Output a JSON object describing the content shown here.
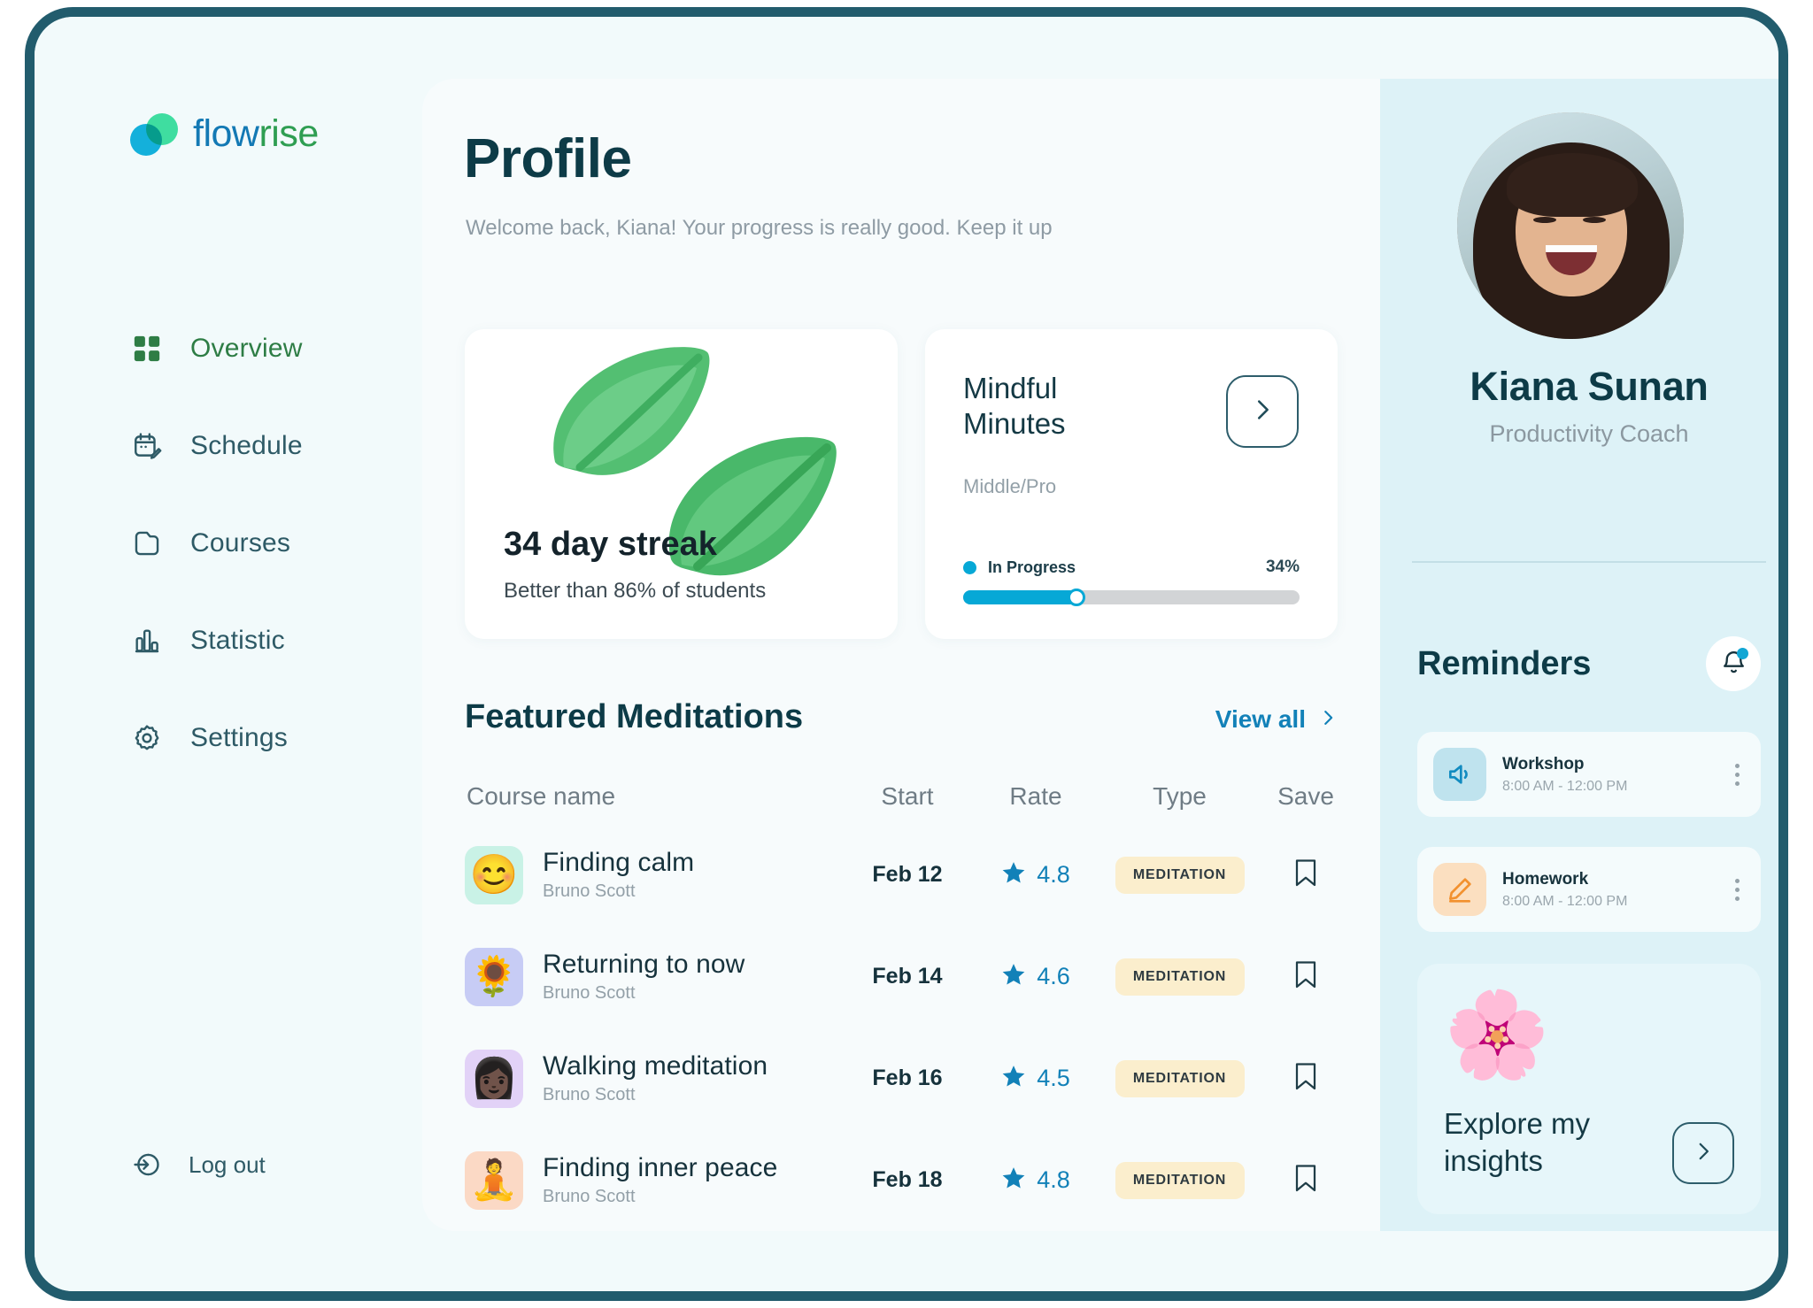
{
  "brand": {
    "name_part1": "flow",
    "name_part2": "rise"
  },
  "sidebar": {
    "items": [
      {
        "label": "Overview",
        "icon": "grid-icon",
        "active": true
      },
      {
        "label": "Schedule",
        "icon": "calendar-edit-icon",
        "active": false
      },
      {
        "label": "Courses",
        "icon": "folder-icon",
        "active": false
      },
      {
        "label": "Statistic",
        "icon": "bar-chart-icon",
        "active": false
      },
      {
        "label": "Settings",
        "icon": "gear-icon",
        "active": false
      }
    ],
    "logout_label": "Log out",
    "logout_icon": "logout-icon"
  },
  "main": {
    "title": "Profile",
    "subtitle": "Welcome back, Kiana! Your progress is really good. Keep it up",
    "streak_card": {
      "value": "34 day streak",
      "subtitle": "Better than 86% of students",
      "illustration": "leaf-icon"
    },
    "mindful_card": {
      "title": "Mindful Minutes",
      "level": "Middle/Pro",
      "progress_label": "In Progress",
      "progress_percent": "34%",
      "progress_value": 34,
      "arrow_icon": "chevron-right-icon"
    },
    "featured": {
      "title": "Featured Meditations",
      "view_all_label": "View all",
      "view_all_icon": "chevron-right-icon",
      "columns": [
        "Course name",
        "Start",
        "Rate",
        "Type",
        "Save"
      ],
      "rows": [
        {
          "name": "Finding calm",
          "author": "Bruno Scott",
          "start": "Feb 12",
          "rate": "4.8",
          "type": "MEDITATION",
          "emoji": "😊",
          "avatar_bg": "#c9f2e6",
          "save_icon": "bookmark-icon"
        },
        {
          "name": "Returning to now",
          "author": "Bruno Scott",
          "start": "Feb 14",
          "rate": "4.6",
          "type": "MEDITATION",
          "emoji": "🌻",
          "avatar_bg": "#c7ccf5",
          "save_icon": "bookmark-icon"
        },
        {
          "name": "Walking meditation",
          "author": "Bruno Scott",
          "start": "Feb 16",
          "rate": "4.5",
          "type": "MEDITATION",
          "emoji": "👩🏿",
          "avatar_bg": "#e2d2f7",
          "save_icon": "bookmark-icon"
        },
        {
          "name": "Finding inner peace",
          "author": "Bruno Scott",
          "start": "Feb 18",
          "rate": "4.8",
          "type": "MEDITATION",
          "emoji": "🧘",
          "avatar_bg": "#fbd9c5",
          "save_icon": "bookmark-icon"
        }
      ]
    }
  },
  "right_panel": {
    "avatar_alt": "user-photo",
    "name": "Kiana Sunan",
    "role": "Productivity Coach",
    "reminders_title": "Reminders",
    "bell_icon": "bell-icon",
    "reminders": [
      {
        "title": "Workshop",
        "time": "8:00 AM - 12:00 PM",
        "icon": "speaker-icon",
        "icon_style": "blue"
      },
      {
        "title": "Homework",
        "time": "8:00 AM - 12:00 PM",
        "icon": "pencil-icon",
        "icon_style": "peach"
      }
    ],
    "insights": {
      "text": "Explore my insights",
      "emoji": "🌸",
      "arrow_icon": "chevron-right-icon"
    }
  },
  "colors": {
    "frame_border": "#225c6d",
    "app_bg": "#f2fafb",
    "main_bg": "#f7fbfc",
    "right_panel_bg": "#ddf2f7",
    "accent_cyan": "#06a8d6",
    "accent_link": "#1281b8",
    "nav_active_green": "#2e7d45",
    "heading": "#0d3b47",
    "badge_bg": "#fbeecd"
  }
}
